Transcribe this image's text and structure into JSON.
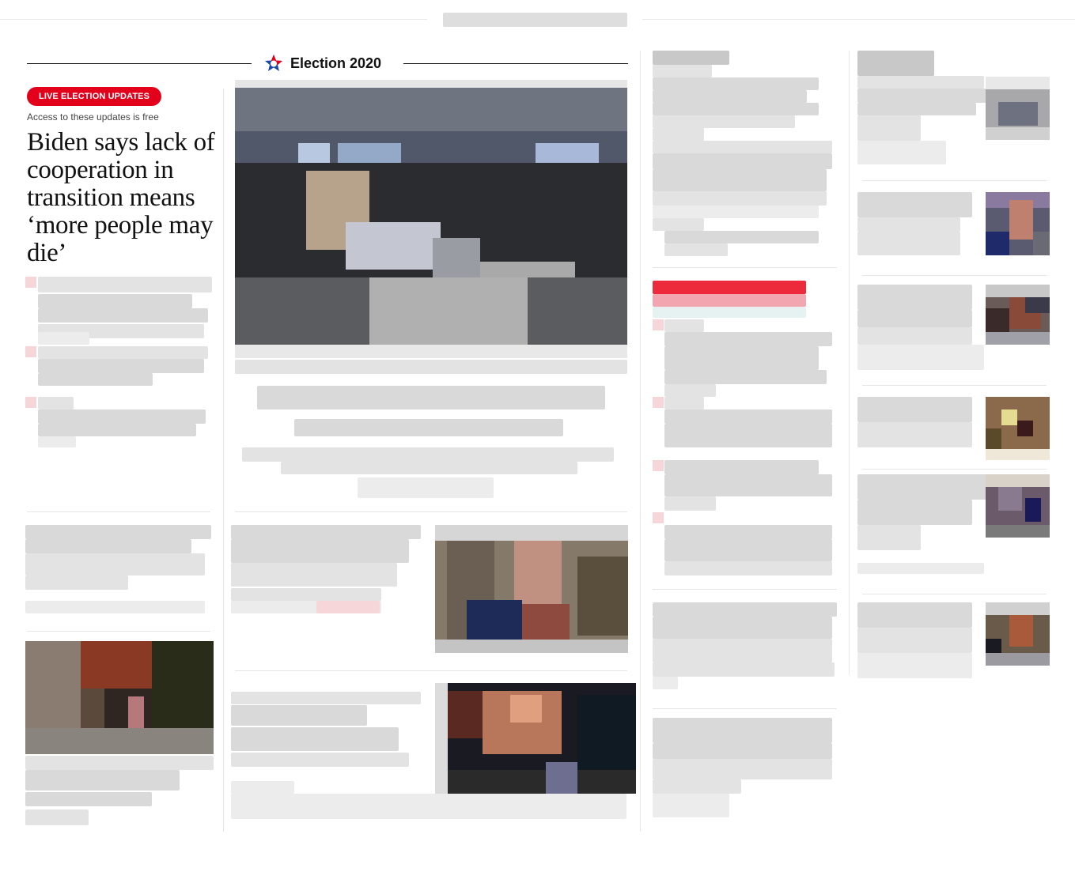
{
  "section_header": {
    "title": "Election 2020",
    "logo_icon": "election-star-icon"
  },
  "lead_story": {
    "badge": "LIVE ELECTION UPDATES",
    "access_note": "Access to these updates is free",
    "headline": "Biden says lack of cooperation in transition means ‘more people may die’"
  },
  "colors": {
    "badge_red": "#e3001b",
    "logo_red": "#e3001b",
    "logo_blue": "#1a4aa8"
  }
}
